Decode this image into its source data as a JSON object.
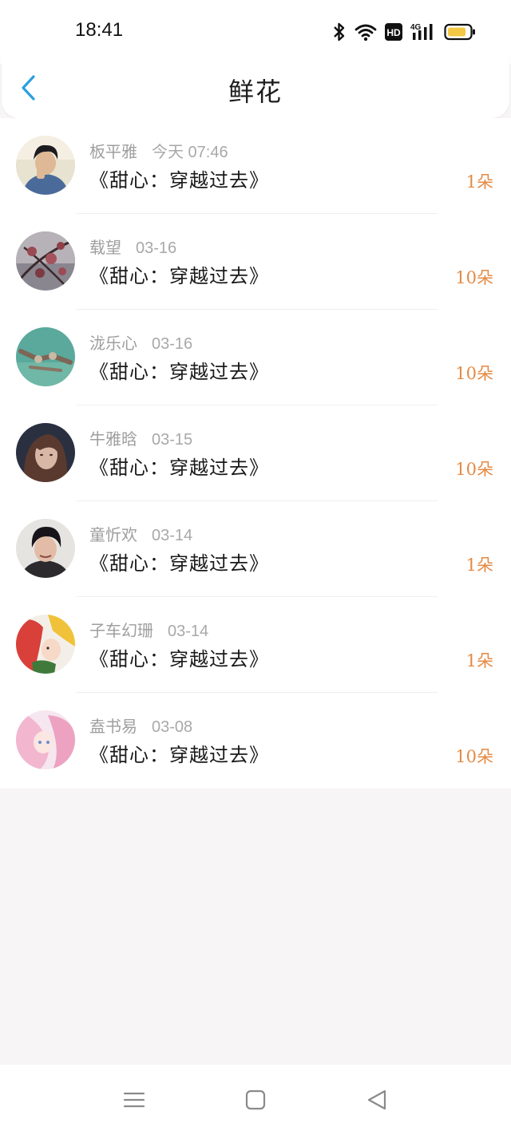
{
  "status": {
    "time": "18:41"
  },
  "header": {
    "title": "鲜花"
  },
  "flowers": [
    {
      "name": "板平雅",
      "date": "今天 07:46",
      "book": "《甜心：穿越过去》",
      "amount": "1朵"
    },
    {
      "name": "载望",
      "date": "03-16",
      "book": "《甜心：穿越过去》",
      "amount": "10朵"
    },
    {
      "name": "泷乐心",
      "date": "03-16",
      "book": "《甜心：穿越过去》",
      "amount": "10朵"
    },
    {
      "name": "牛雅晗",
      "date": "03-15",
      "book": "《甜心：穿越过去》",
      "amount": "10朵"
    },
    {
      "name": "童忻欢",
      "date": "03-14",
      "book": "《甜心：穿越过去》",
      "amount": "1朵"
    },
    {
      "name": "子车幻珊",
      "date": "03-14",
      "book": "《甜心：穿越过去》",
      "amount": "1朵"
    },
    {
      "name": "盍书易",
      "date": "03-08",
      "book": "《甜心：穿越过去》",
      "amount": "10朵"
    }
  ],
  "colors": {
    "accent": "#2c9fe0",
    "amount": "#e48a43",
    "background": "#f7f5f6"
  },
  "icons": [
    "bluetooth-icon",
    "wifi-icon",
    "hd-icon",
    "signal-4g-icon",
    "battery-icon",
    "back-arrow-icon",
    "menu-icon",
    "home-icon",
    "back-triangle-icon"
  ]
}
